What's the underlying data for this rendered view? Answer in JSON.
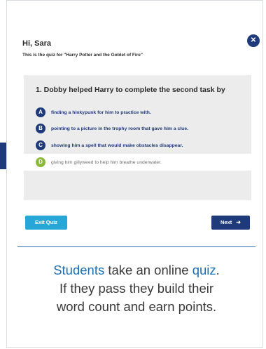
{
  "header": {
    "greeting": "Hi, Sara",
    "subtitle": "This is the quiz for \"Harry Potter and the Goblet of Fire\"",
    "close_icon": "close-icon"
  },
  "quiz": {
    "question": "1. Dobby helped Harry to complete the second task by",
    "options": [
      {
        "letter": "A",
        "text": "finding a hinkypunk for him to practice with."
      },
      {
        "letter": "B",
        "text": "pointing to a picture in the trophy room that gave him a clue."
      },
      {
        "letter": "C",
        "text": "showing him a spell that would make obstacles disappear."
      },
      {
        "letter": "D",
        "text": "giving him gillyweed to help him breathe underwater.",
        "selected": true
      }
    ]
  },
  "footer": {
    "exit_label": "Exit Quiz",
    "next_label": "Next",
    "next_icon": "arrow-right-icon"
  },
  "caption": {
    "word1": "Students",
    "part1": " take an online ",
    "word2": "quiz",
    "part2": ".",
    "line2": "If they pass they build their",
    "line3": "word count and earn points."
  },
  "colors": {
    "navy": "#1f3a7a",
    "light_blue": "#27a7d8",
    "green": "#8ab935",
    "caption_highlight": "#1d6fb1"
  }
}
